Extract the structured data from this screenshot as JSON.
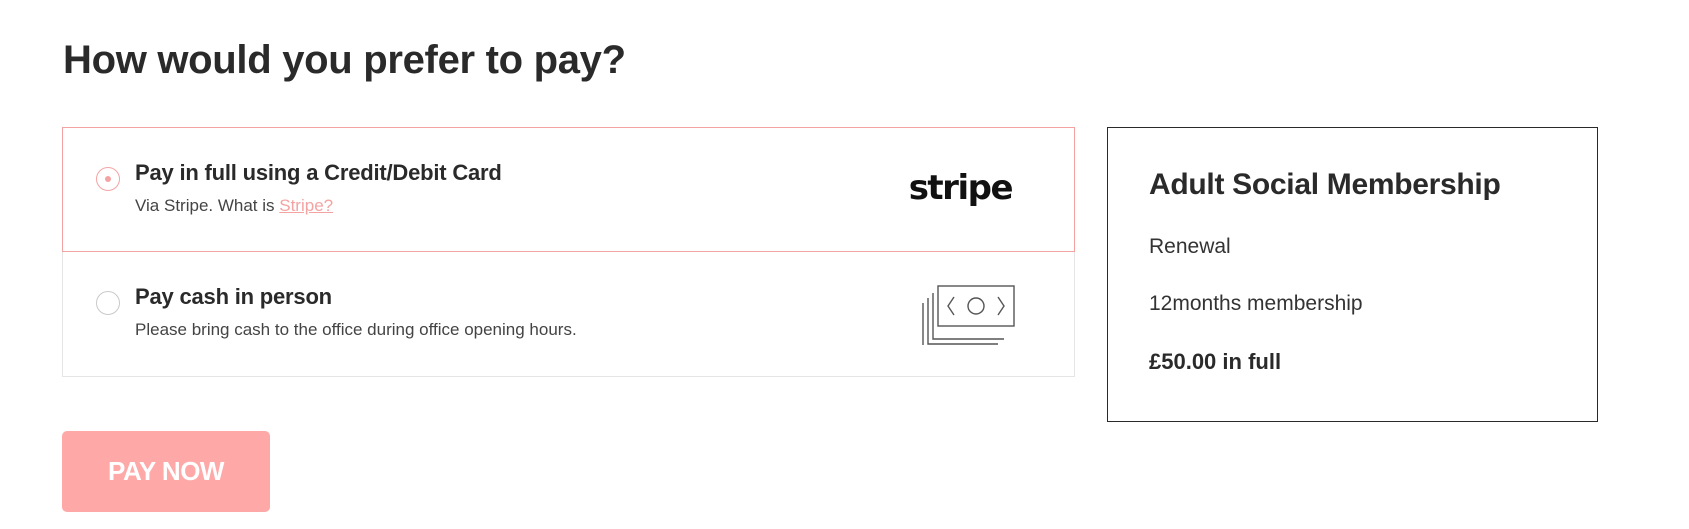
{
  "page": {
    "title": "How would you prefer to pay?"
  },
  "payment_options": [
    {
      "id": "card",
      "selected": true,
      "title": "Pay in full using a Credit/Debit Card",
      "desc_prefix": "Via Stripe. What is ",
      "desc_link": "Stripe?",
      "logo_text": "stripe",
      "icon": "stripe-logo"
    },
    {
      "id": "cash",
      "selected": false,
      "title": "Pay cash in person",
      "desc": "Please bring cash to the office during office opening hours.",
      "icon": "cash-icon"
    }
  ],
  "summary": {
    "title": "Adult Social Membership",
    "type": "Renewal",
    "duration": "12months membership",
    "price": "£50.00 in full"
  },
  "actions": {
    "pay_label": "PAY NOW"
  },
  "colors": {
    "accent": "#f4a3a3",
    "button_bg": "#ffa8a8",
    "text": "#2a2a2a",
    "border": "#e5e5e5"
  }
}
